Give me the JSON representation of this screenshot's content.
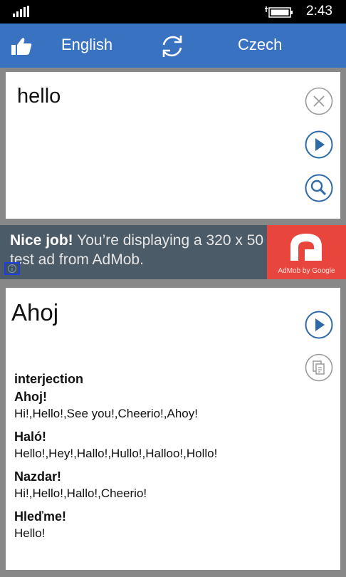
{
  "status_bar": {
    "time": "2:43"
  },
  "top_bar": {
    "source_language": "English",
    "target_language": "Czech"
  },
  "input": {
    "text": "hello"
  },
  "ad": {
    "headline_bold": "Nice job!",
    "headline_rest": " You’re displaying a 320 x 50 test ad from AdMob.",
    "logo_caption": "AdMob by Google"
  },
  "result": {
    "translation": "Ahoj",
    "part_of_speech": "interjection",
    "entries": [
      {
        "word": "Ahoj!",
        "translations": "Hi!,Hello!,See you!,Cheerio!,Ahoy!"
      },
      {
        "word": "Haló!",
        "translations": "Hello!,Hey!,Hallo!,Hullo!,Halloo!,Hollo!"
      },
      {
        "word": "Nazdar!",
        "translations": "Hi!,Hello!,Hallo!,Cheerio!"
      },
      {
        "word": "Hleďme!",
        "translations": "Hello!"
      }
    ]
  },
  "colors": {
    "accent": "#3a72c2",
    "icon_blue": "#2e6aa8",
    "ad_background": "#4b5b67",
    "ad_logo": "#e8453c"
  },
  "icons": [
    "signal-icon",
    "battery-icon",
    "thumbs-up-icon",
    "swap-icon",
    "clear-icon",
    "play-icon",
    "search-icon",
    "copy-icon",
    "info-icon"
  ]
}
